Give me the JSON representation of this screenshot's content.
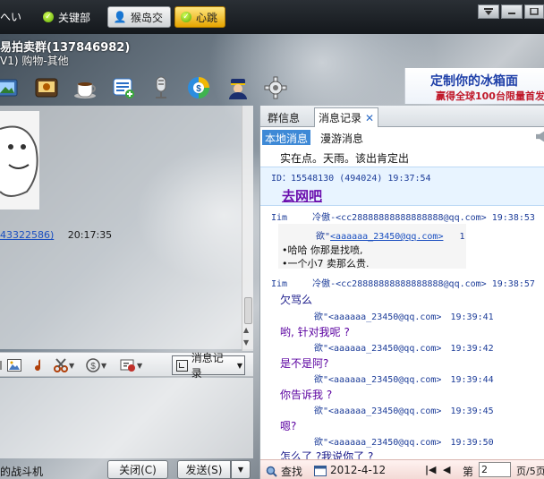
{
  "top_tabs": {
    "partial_left": "へい",
    "items": [
      {
        "label": "关键部",
        "state": "normal"
      },
      {
        "label": "猴岛交",
        "state": "active"
      },
      {
        "label": "心跳",
        "state": "highlight"
      }
    ]
  },
  "header": {
    "name": "易拍卖群(137846982)",
    "status": "V1) 购物-其他"
  },
  "ad": {
    "line1": "定制你的冰箱面",
    "line2": "赢得全球100台限量首发"
  },
  "left": {
    "link_text": "43322586)",
    "time": "20:17:35"
  },
  "input_toolbar": {
    "msg_record_label": "消息记录"
  },
  "bottom": {
    "label": "的战斗机",
    "close_label": "关闭(C)",
    "send_label": "发送(S)"
  },
  "right": {
    "tabs": [
      {
        "label": "群信息"
      },
      {
        "label": "消息记录"
      }
    ],
    "close_glyph": "✕",
    "subtabs": [
      {
        "label": "本地消息"
      },
      {
        "label": "漫游消息"
      }
    ],
    "messages": {
      "m0": "实在点。天雨。该出肯定出",
      "m1_header": "ID：15548130 (494024) 19:37:54",
      "m1_text": "去网吧",
      "m2_name": "Iim",
      "m2_email": "冷傲-<cc28888888888888888@qq.com>",
      "m2_time": "19:38:53",
      "m3_prefix": "欲\"",
      "m3_email": "<aaaaaa_23450@qq.com>",
      "m3_suffix": "1",
      "m4": "•哈哈  你那是找喷,",
      "m5": "•一个小7  卖那么贵.",
      "m6_name": "Iim",
      "m6_email": "冷傲-<cc28888888888888888@qq.com>",
      "m6_time": "19:38:57",
      "m7": "欠骂么",
      "m8_sender": "欲\"<aaaaaa_23450@qq.com>",
      "m8_time": "19:39:41",
      "m9": "哟, 针对我呢 ?",
      "m10_sender": "欲\"<aaaaaa_23450@qq.com>",
      "m10_time": "19:39:42",
      "m11": "是不是阿?",
      "m12_sender": "欲\"<aaaaaa_23450@qq.com>",
      "m12_time": "19:39:44",
      "m13": "你告诉我 ?",
      "m14_sender": "欲\"<aaaaaa_23450@qq.com>",
      "m14_time": "19:39:45",
      "m15": "嗯?",
      "m16_sender": "欲\"<aaaaaa_23450@qq.com>",
      "m16_time": "19:39:50",
      "m17": "怎么了 ?我说你了 ?"
    },
    "footer": {
      "search_label": "查找",
      "date": "2012-4-12",
      "page_prefix": "第",
      "page_value": "2",
      "page_suffix": "页/5页"
    }
  }
}
